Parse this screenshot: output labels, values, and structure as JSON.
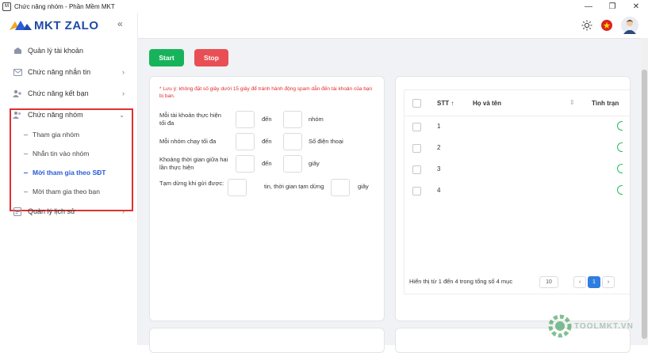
{
  "window": {
    "title": "Chức năng nhóm - Phần Mềm MKT",
    "minimize": "—",
    "restore": "❐",
    "close": "✕"
  },
  "logo": {
    "text": "MKT ZALO"
  },
  "sidebar": {
    "items": [
      {
        "label": "Quản lý tài khoản"
      },
      {
        "label": "Chức năng nhắn tin"
      },
      {
        "label": "Chức năng kết bạn"
      },
      {
        "label": "Chức năng nhóm"
      },
      {
        "label": "Quản lý lịch sử"
      }
    ],
    "sub_items": [
      {
        "label": "Tham gia nhóm"
      },
      {
        "label": "Nhắn tin vào nhóm"
      },
      {
        "label": "Mời tham gia theo SĐT"
      },
      {
        "label": "Mời tham gia theo bạn"
      }
    ]
  },
  "toolbar": {
    "start_label": "Start",
    "stop_label": "Stop"
  },
  "form": {
    "note": "* Lưu ý: không đặt số giây dưới 15 giây để tránh hành động spam dẫn đến tài khoản của bạn bị ban.",
    "row1_label": "Mỗi tài khoản thực hiện tối đa",
    "row1_mid": "đến",
    "row1_unit": "nhóm",
    "row2_label": "Mỗi nhóm chạy tối đa",
    "row2_mid": "đến",
    "row2_unit": "Số điện thoại",
    "row3_label": "Khoảng thời gian giữa hai lần thực hiện",
    "row3_mid": "đến",
    "row3_unit": "giây",
    "row4_label": "Tạm dừng khi gửi được:",
    "row4_mid": "tin, thời gian tạm dừng",
    "row4_unit": "giây"
  },
  "table": {
    "columns": [
      "STT ↑",
      "Họ và tên",
      "Tình trạn"
    ],
    "rows": [
      {
        "stt": "1"
      },
      {
        "stt": "2"
      },
      {
        "stt": "3"
      },
      {
        "stt": "4"
      }
    ],
    "footer": "Hiển thị từ 1 đến 4 trong tổng số 4 mục",
    "page_size": "10",
    "prev": "‹",
    "page": "1",
    "next": "›"
  },
  "watermark": {
    "text": "TOOLMKT.VN"
  }
}
